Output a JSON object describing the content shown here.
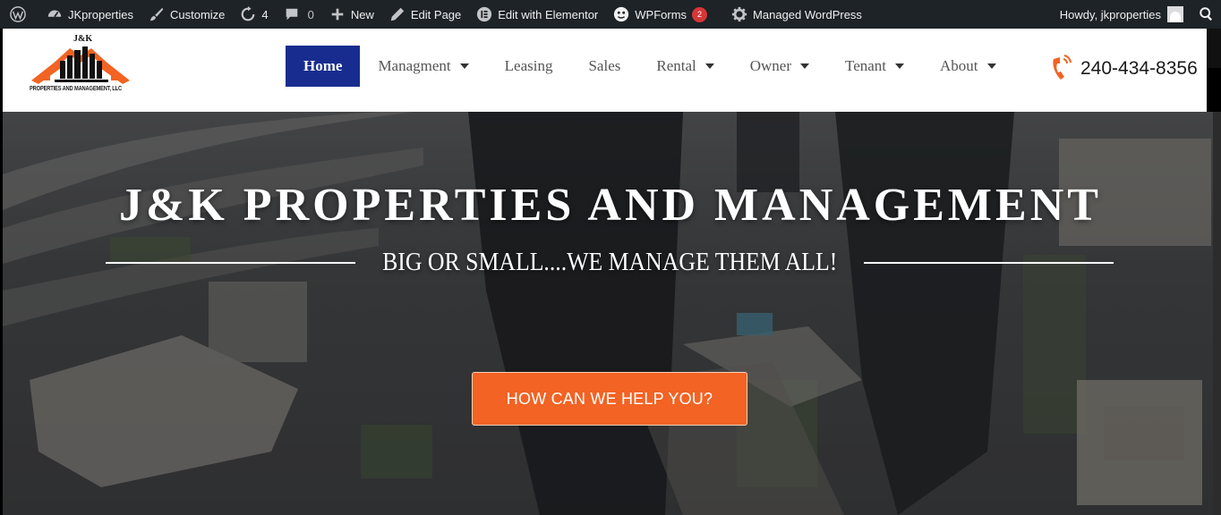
{
  "adminbar": {
    "site_name": "JKproperties",
    "customize": "Customize",
    "updates_count": "4",
    "comments_count": "0",
    "new": "New",
    "edit_page": "Edit Page",
    "edit_elementor": "Edit with Elementor",
    "wpforms": "WPForms",
    "wpforms_badge": "2",
    "managed_wp": "Managed WordPress",
    "howdy": "Howdy, jkproperties"
  },
  "logo": {
    "monogram": "J&K",
    "tagline": "PROPERTIES AND MANAGEMENT, LLC"
  },
  "nav": {
    "items": [
      {
        "label": "Home",
        "active": true,
        "dropdown": false
      },
      {
        "label": "Managment",
        "active": false,
        "dropdown": true
      },
      {
        "label": "Leasing",
        "active": false,
        "dropdown": false
      },
      {
        "label": "Sales",
        "active": false,
        "dropdown": false
      },
      {
        "label": "Rental",
        "active": false,
        "dropdown": true
      },
      {
        "label": "Owner",
        "active": false,
        "dropdown": true
      },
      {
        "label": "Tenant",
        "active": false,
        "dropdown": true
      },
      {
        "label": "About",
        "active": false,
        "dropdown": true
      }
    ]
  },
  "phone": {
    "number": "240-434-8356",
    "icon": "phone-icon"
  },
  "hero": {
    "title": "J&K PROPERTIES AND MANAGEMENT",
    "subtitle": "BIG OR SMALL....WE MANAGE THEM ALL!",
    "cta_label": "HOW CAN WE HELP YOU?"
  },
  "colors": {
    "adminbar_bg": "#1d2327",
    "nav_active_bg": "#182c8f",
    "accent_orange": "#f26324"
  }
}
